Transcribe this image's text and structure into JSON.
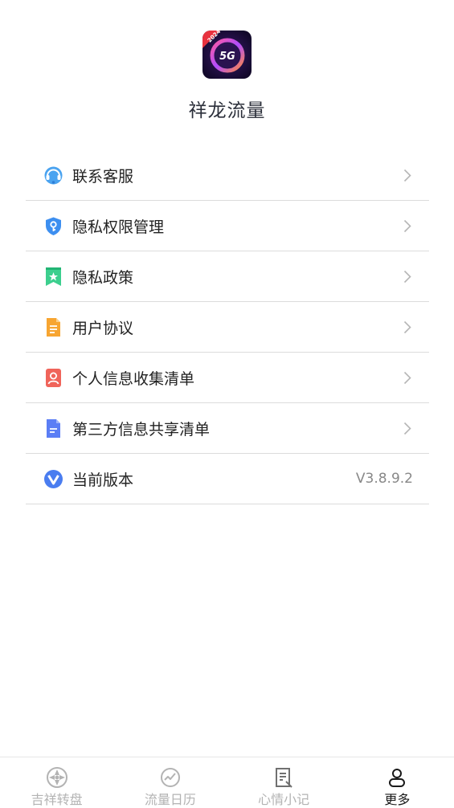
{
  "app": {
    "name": "祥龙流量",
    "logo_text": "5G",
    "logo_badge": "2024"
  },
  "menu": [
    {
      "label": "联系客服",
      "icon": "headset-icon"
    },
    {
      "label": "隐私权限管理",
      "icon": "shield-key-icon"
    },
    {
      "label": "隐私政策",
      "icon": "bookmark-star-icon"
    },
    {
      "label": "用户协议",
      "icon": "document-icon"
    },
    {
      "label": "个人信息收集清单",
      "icon": "person-card-icon"
    },
    {
      "label": "第三方信息共享清单",
      "icon": "file-icon"
    },
    {
      "label": "当前版本",
      "icon": "v-badge-icon",
      "value": "V3.8.9.2"
    }
  ],
  "tabbar": [
    {
      "label": "吉祥转盘",
      "icon": "wheel-icon",
      "active": false
    },
    {
      "label": "流量日历",
      "icon": "chart-circle-icon",
      "active": false
    },
    {
      "label": "心情小记",
      "icon": "note-icon",
      "active": false
    },
    {
      "label": "更多",
      "icon": "person-icon",
      "active": true
    }
  ],
  "colors": {
    "active_tab": "#1a1a1a",
    "inactive_tab": "#b3b3b3",
    "divider": "#dcdcdc"
  }
}
